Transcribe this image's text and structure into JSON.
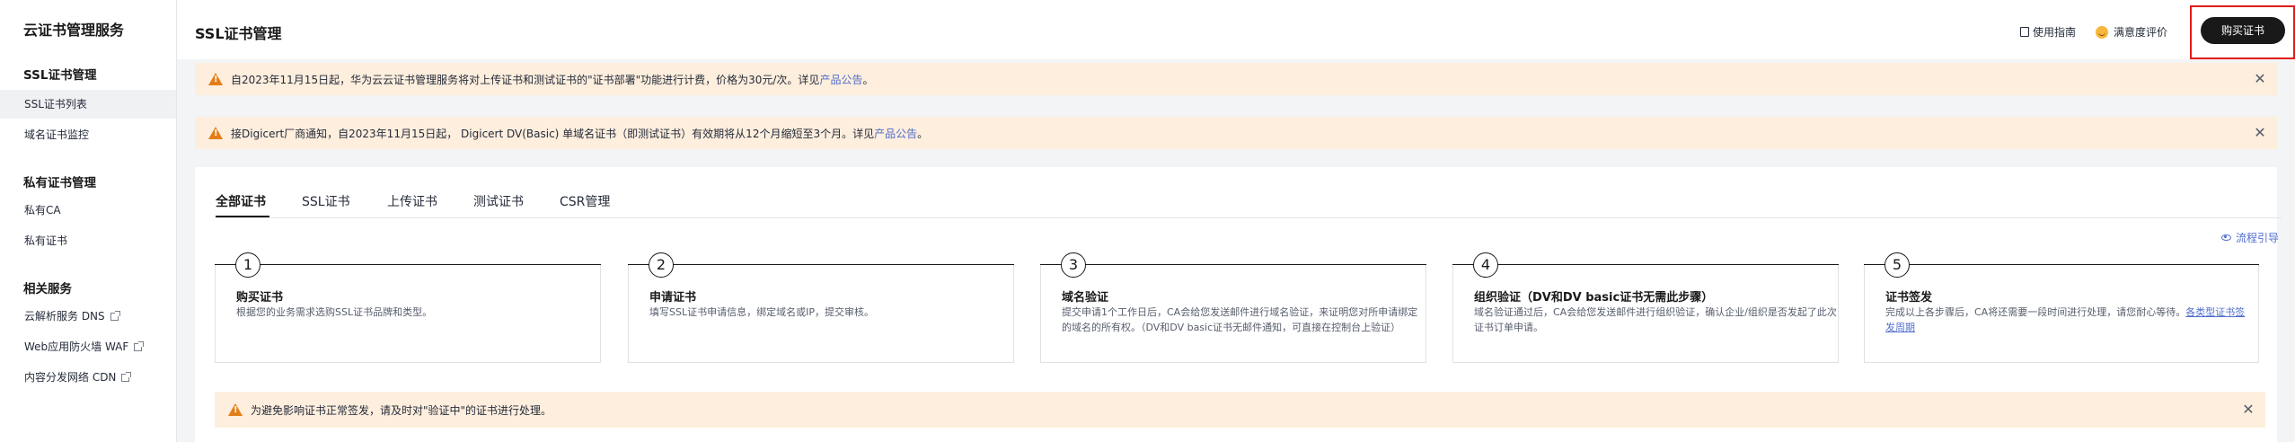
{
  "sidebar": {
    "title": "云证书管理服务",
    "groups": [
      {
        "label": "SSL证书管理",
        "items": [
          "SSL证书列表",
          "域名证书监控"
        ]
      },
      {
        "label": "私有证书管理",
        "items": [
          "私有CA",
          "私有证书"
        ]
      },
      {
        "label": "相关服务",
        "items": [
          "云解析服务 DNS",
          "Web应用防火墙 WAF",
          "内容分发网络 CDN"
        ]
      }
    ]
  },
  "header": {
    "title": "SSL证书管理",
    "guide_label": "使用指南",
    "rating_label": "满意度评价",
    "buy_button": "购买证书"
  },
  "notices": [
    {
      "text": "自2023年11月15日起，华为云云证书管理服务将对上传证书和测试证书的\"证书部署\"功能进行计费，价格为30元/次。详见",
      "link": "产品公告",
      "suffix": "。"
    },
    {
      "text": "接Digicert厂商通知，自2023年11月15日起， Digicert DV(Basic) 单域名证书（即测试证书）有效期将从12个月缩短至3个月。详见",
      "link": "产品公告",
      "suffix": "。"
    }
  ],
  "tabs": [
    "全部证书",
    "SSL证书",
    "上传证书",
    "测试证书",
    "CSR管理"
  ],
  "flow_guide": "流程引导",
  "steps": [
    {
      "num": "1",
      "title": "购买证书",
      "desc": "根据您的业务需求选购SSL证书品牌和类型。",
      "link": ""
    },
    {
      "num": "2",
      "title": "申请证书",
      "desc": "填写SSL证书申请信息，绑定域名或IP，提交审核。",
      "link": ""
    },
    {
      "num": "3",
      "title": "域名验证",
      "desc": "提交申请1个工作日后，CA会给您发送邮件进行域名验证，来证明您对所申请绑定的域名的所有权。（DV和DV basic证书无邮件通知，可直接在控制台上验证）",
      "link": ""
    },
    {
      "num": "4",
      "title": "组织验证（DV和DV basic证书无需此步骤）",
      "desc": "域名验证通过后，CA会给您发送邮件进行组织验证，确认企业/组织是否发起了此次证书订单申请。",
      "link": ""
    },
    {
      "num": "5",
      "title": "证书签发",
      "desc": "完成以上各步骤后，CA将还需要一段时间进行处理，请您耐心等待。",
      "link": "各类型证书签发周期"
    }
  ],
  "bottom_notice": "为避免影响证书正常签发，请及时对\"验证中\"的证书进行处理。",
  "colors": {
    "accent": "#191919",
    "link": "#526ecc",
    "warning": "#e37e18",
    "notice_bg": "#fdeedd",
    "highlight": "#e21b1b"
  }
}
